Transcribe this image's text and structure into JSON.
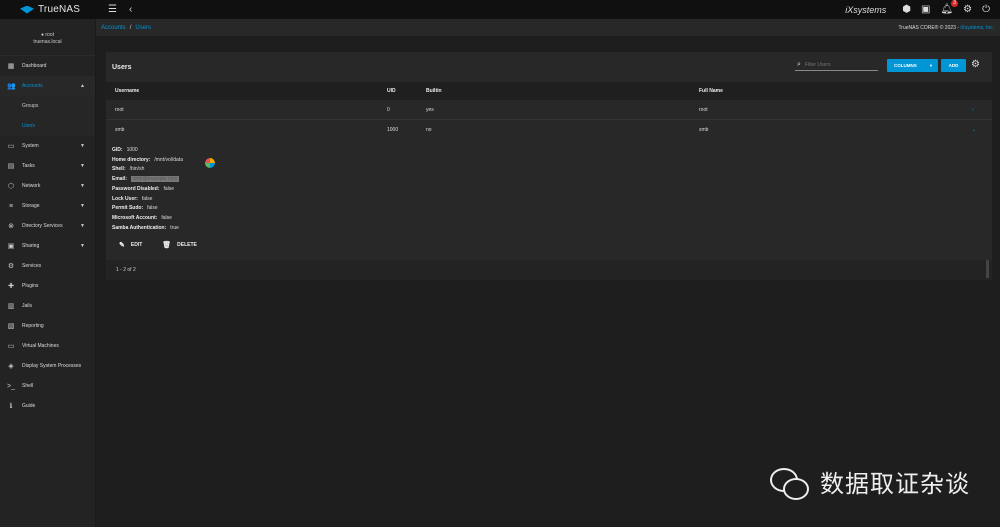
{
  "app": {
    "name": "TrueNAS",
    "sub": "CORE"
  },
  "topbar": {
    "menu_icon": "☰",
    "back_icon": "‹",
    "brand": "iXsystems",
    "notifications_count": "3"
  },
  "user": {
    "name": "root",
    "host": "truenas.local"
  },
  "sidebar": {
    "items": [
      {
        "label": "Dashboard",
        "icon": "▦"
      },
      {
        "label": "Accounts",
        "icon": "👥",
        "chevron": "▲"
      },
      {
        "label": "System",
        "icon": "▭",
        "chevron": "▼"
      },
      {
        "label": "Tasks",
        "icon": "▤",
        "chevron": "▼"
      },
      {
        "label": "Network",
        "icon": "⬡",
        "chevron": "▼"
      },
      {
        "label": "Storage",
        "icon": "≡",
        "chevron": "▼"
      },
      {
        "label": "Directory Services",
        "icon": "⊗",
        "chevron": "▼"
      },
      {
        "label": "Sharing",
        "icon": "▣",
        "chevron": "▼"
      },
      {
        "label": "Services",
        "icon": "⚙"
      },
      {
        "label": "Plugins",
        "icon": "✚"
      },
      {
        "label": "Jails",
        "icon": "▥"
      },
      {
        "label": "Reporting",
        "icon": "▧"
      },
      {
        "label": "Virtual Machines",
        "icon": "▭"
      },
      {
        "label": "Display System Processes",
        "icon": "◈"
      },
      {
        "label": "Shell",
        "icon": ">_"
      },
      {
        "label": "Guide",
        "icon": "ℹ"
      }
    ],
    "accounts_sub": [
      "Groups",
      "Users"
    ]
  },
  "breadcrumb": {
    "parent": "Accounts",
    "sep": "/",
    "current": "Users"
  },
  "copyright": {
    "text": "TrueNAS CORE® © 2023 - ",
    "link": "iXsystems, Inc."
  },
  "card": {
    "title": "Users",
    "filter_placeholder": "Filter Users",
    "columns_label": "COLUMNS",
    "add_label": "ADD"
  },
  "table": {
    "headers": [
      "Username",
      "UID",
      "Builtin",
      "Full Name"
    ],
    "rows": [
      {
        "username": "root",
        "uid": "0",
        "builtin": "yes",
        "full_name": "root",
        "toggle": "›"
      },
      {
        "username": "smb",
        "uid": "1000",
        "builtin": "no",
        "full_name": "smb",
        "toggle": "⌄"
      }
    ]
  },
  "detail": {
    "gid_label": "GID:",
    "gid": "1000",
    "home_label": "Home directory:",
    "home": "/mnt/vol/data",
    "shell_label": "Shell:",
    "shell": "/bin/sh",
    "email_label": "Email:",
    "email": "smb@example.com",
    "pwd_label": "Password Disabled:",
    "pwd": "false",
    "lock_label": "Lock User:",
    "lock": "false",
    "sudo_label": "Permit Sudo:",
    "sudo": "false",
    "ms_label": "Microsoft Account:",
    "ms": "false",
    "samba_label": "Samba Authentication:",
    "samba": "true",
    "edit_label": "EDIT",
    "delete_label": "DELETE"
  },
  "footer": {
    "range": "1 - 2 of 2"
  },
  "watermark": {
    "text": "数据取证杂谈"
  }
}
